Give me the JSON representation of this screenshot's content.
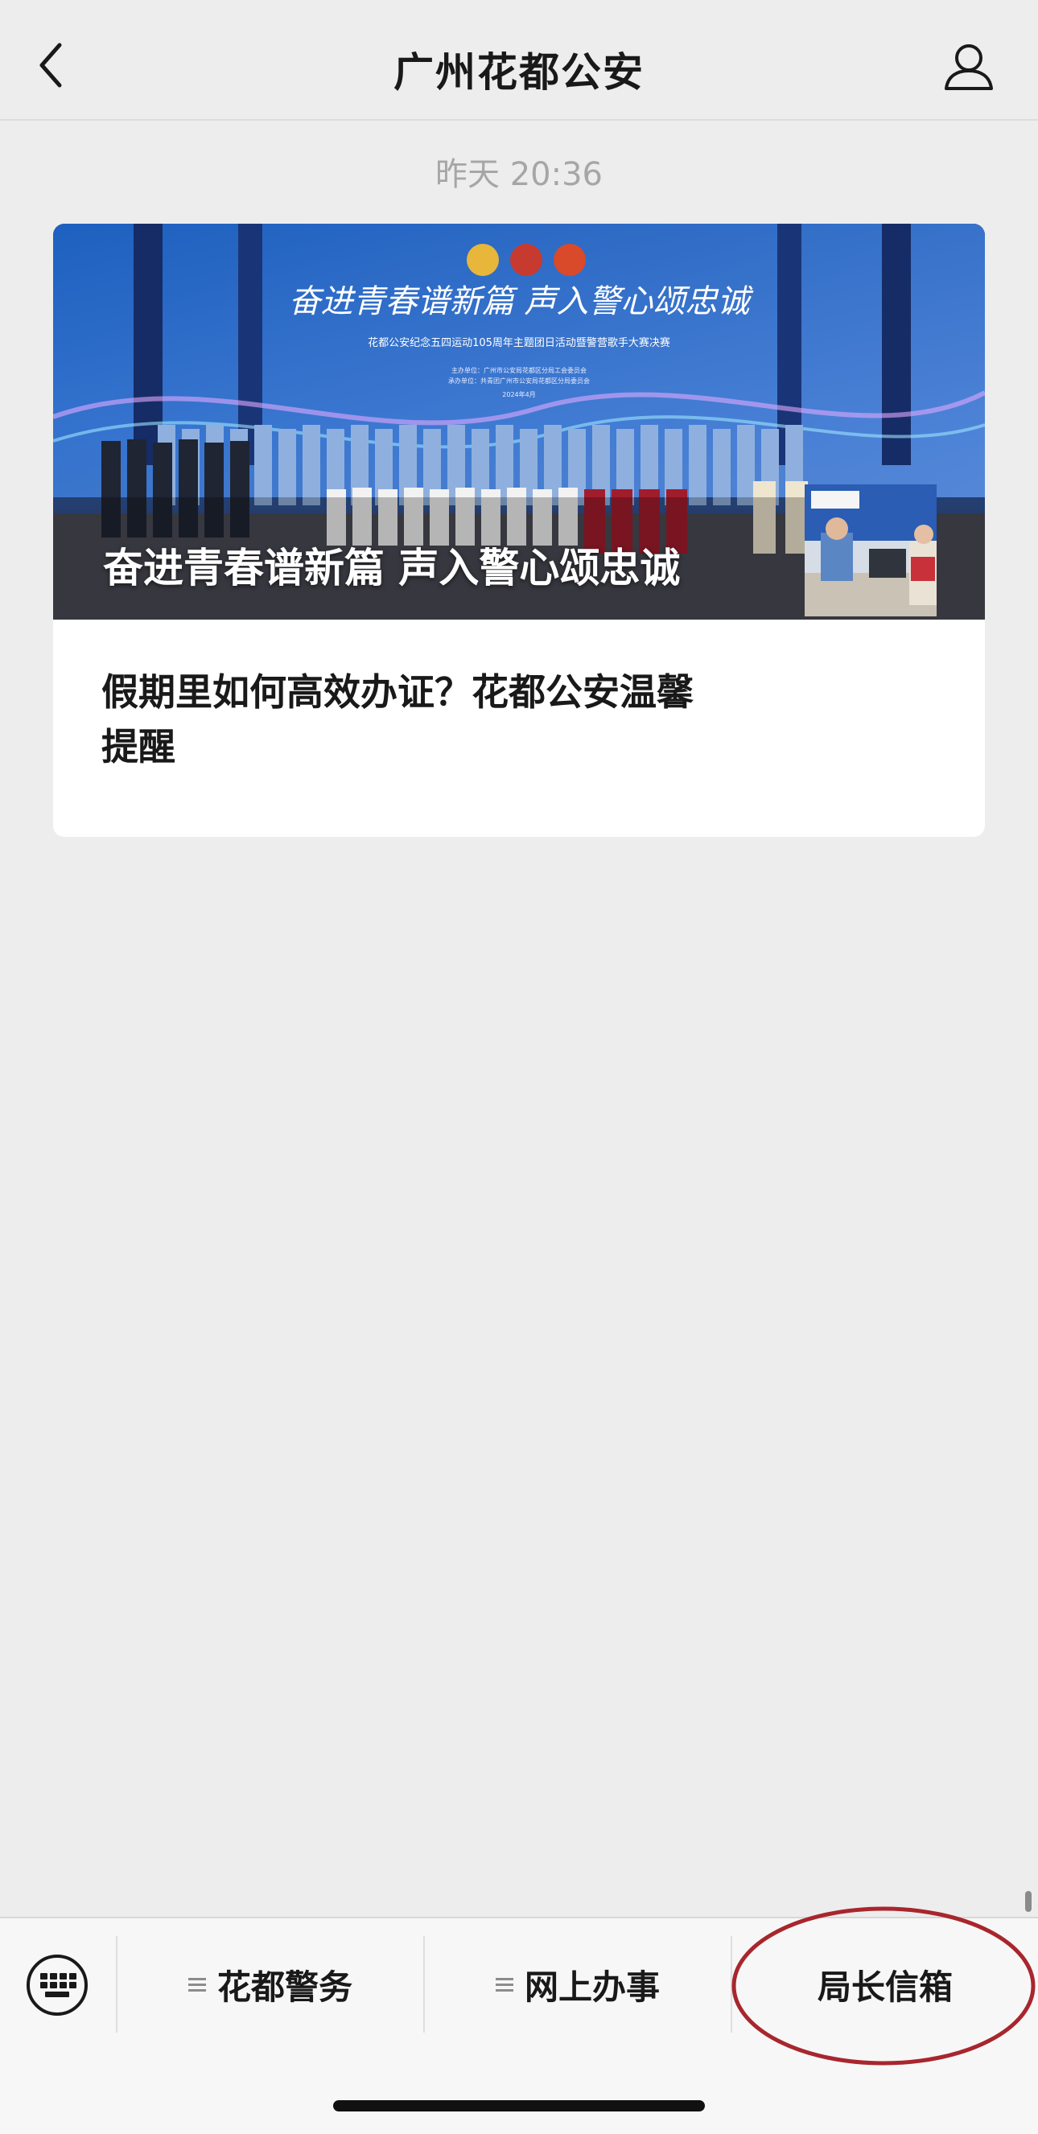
{
  "header": {
    "title": "广州花都公安",
    "back_icon": "chevron-left-icon",
    "profile_icon": "person-icon"
  },
  "message": {
    "timestamp": "昨天 20:36"
  },
  "card": {
    "hero": {
      "caption": "奋进青春谱新篇 声入警心颂忠诚",
      "banner_headline": "奋进青春谱新篇 声入警心颂忠诚",
      "banner_subtitle": "花都公安纪念五四运动105周年主题团日活动暨警营歌手大赛决赛",
      "banner_line1": "主办单位：广州市公安局花都区分局工会委员会",
      "banner_line2": "承办单位：共青团广州市公安局花都区分局委员会",
      "banner_date": "2024年4月"
    },
    "article": {
      "title_line1": "假期里如何高效办证？花都公安温馨",
      "title_line2": "提醒"
    }
  },
  "menu": {
    "keyboard_icon": "keyboard-icon",
    "items": [
      {
        "label": "花都警务"
      },
      {
        "label": "网上办事"
      },
      {
        "label": "局长信箱"
      }
    ],
    "highlight_color": "#a8262d"
  }
}
